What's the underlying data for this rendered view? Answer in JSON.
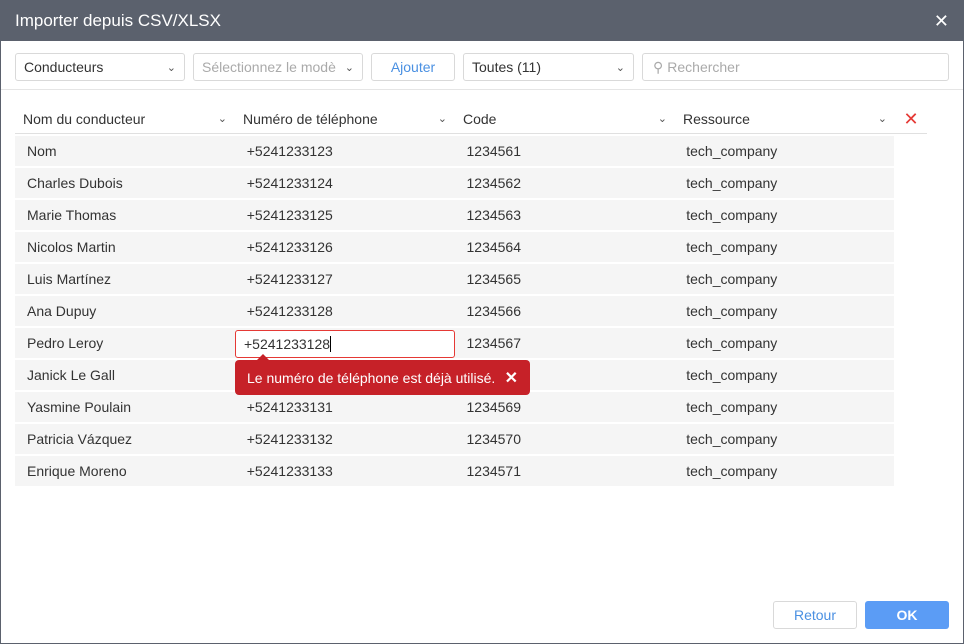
{
  "title": "Importer depuis CSV/XLSX",
  "toolbar": {
    "entity": "Conducteurs",
    "template_placeholder": "Sélectionnez le modè",
    "add": "Ajouter",
    "filter": "Toutes (11)",
    "search_placeholder": "Rechercher"
  },
  "columns": [
    "Nom du conducteur",
    "Numéro de téléphone",
    "Code",
    "Ressource"
  ],
  "rows": [
    [
      "Nom",
      "+5241233123",
      "1234561",
      "tech_company"
    ],
    [
      "Charles Dubois",
      "+5241233124",
      "1234562",
      "tech_company"
    ],
    [
      "Marie Thomas",
      "+5241233125",
      "1234563",
      "tech_company"
    ],
    [
      "Nicolos Martin",
      "+5241233126",
      "1234564",
      "tech_company"
    ],
    [
      "Luis Martínez",
      "+5241233127",
      "1234565",
      "tech_company"
    ],
    [
      "Ana Dupuy",
      "+5241233128",
      "1234566",
      "tech_company"
    ],
    [
      "Pedro Leroy",
      "",
      "1234567",
      "tech_company"
    ],
    [
      "Janick Le Gall",
      "",
      "",
      "tech_company"
    ],
    [
      "Yasmine Poulain",
      "+5241233131",
      "1234569",
      "tech_company"
    ],
    [
      "Patricia Vázquez",
      "+5241233132",
      "1234570",
      "tech_company"
    ],
    [
      "Enrique Moreno",
      "+5241233133",
      "1234571",
      "tech_company"
    ]
  ],
  "edit_value": "+5241233128",
  "error": "Le numéro de téléphone est déjà utilisé.",
  "footer": {
    "back": "Retour",
    "ok": "OK"
  },
  "colors": {
    "accent": "#4a90e2",
    "error": "#c62128",
    "titlebar": "#5b616d"
  }
}
